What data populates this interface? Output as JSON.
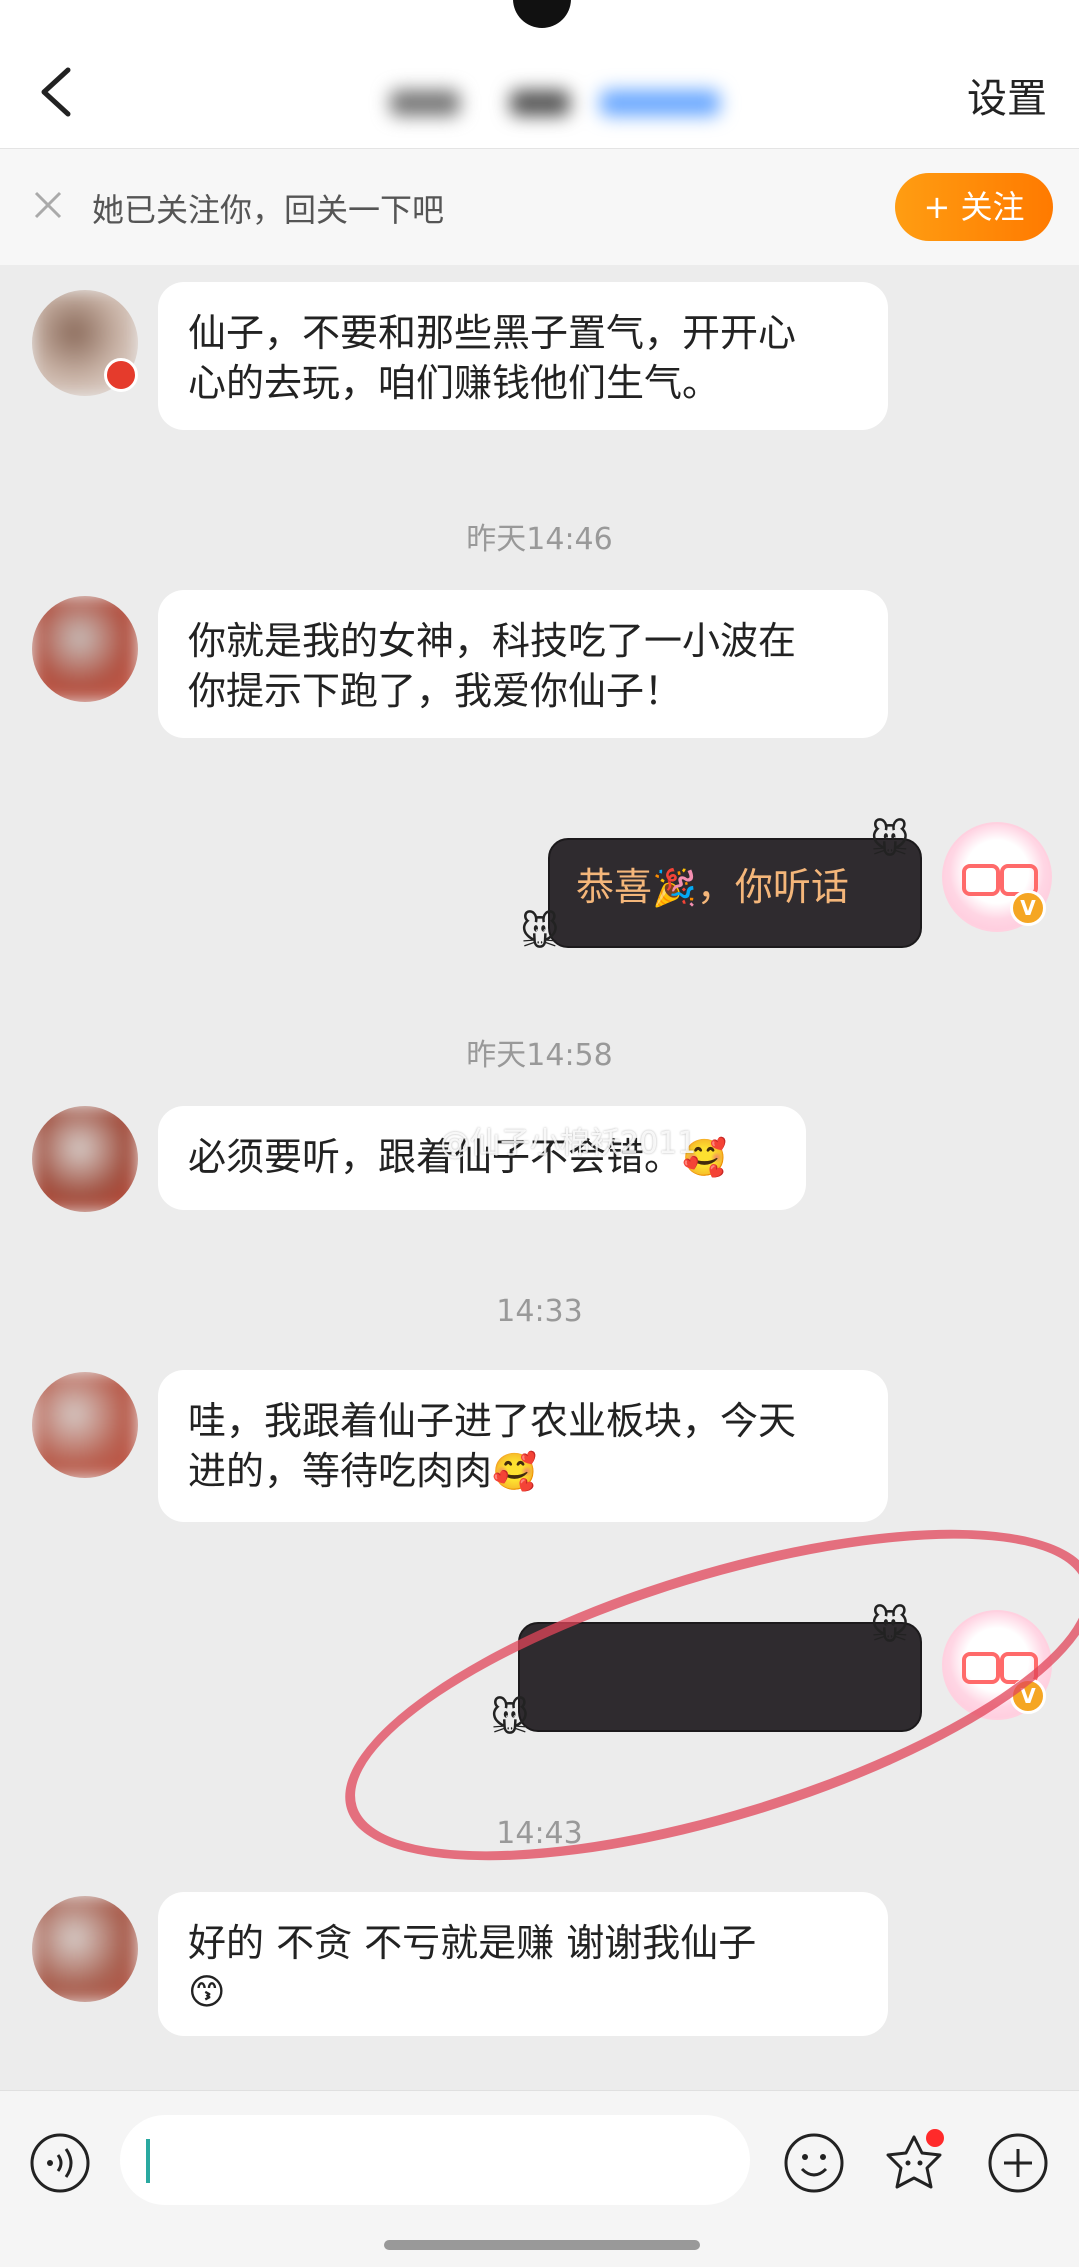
{
  "header": {
    "settings_label": "设置"
  },
  "follow_banner": {
    "text": "她已关注你，回关一下吧",
    "button_label": "+ 关注"
  },
  "messages": [
    {
      "side": "left",
      "text_lines": [
        "仙子，不要和那些黑子置气，开开心",
        "心的去玩，咱们赚钱他们生气。"
      ]
    },
    {
      "side": "left",
      "text_lines": [
        "你就是我的女神，科技吃了一小波在",
        "你提示下跑了，我爱你仙子！"
      ]
    },
    {
      "side": "right",
      "text_a": "恭喜",
      "emoji": "🎉",
      "text_b": "，你听话"
    },
    {
      "side": "left",
      "text": "必须要听，跟着仙子不会错。",
      "emoji": "🥰"
    },
    {
      "side": "left",
      "text_lines": [
        "哇，我跟着仙子进了农业板块，今天",
        "进的，等待吃肉肉"
      ],
      "emoji": "🥰"
    },
    {
      "side": "right",
      "text": ""
    },
    {
      "side": "left",
      "text_lines": [
        "好的  不贪  不亏就是赚 谢谢我仙子"
      ],
      "emoji": "😙"
    }
  ],
  "timestamps": [
    "昨天14:46",
    "昨天14:58",
    "14:33",
    "14:43"
  ],
  "watermark": "@仙子小棉袄2011",
  "colors": {
    "accent": "#ff8c0a",
    "dark_bubble": "#2f2b2f",
    "bubble_text_gold": "#f4b67a"
  },
  "icons": [
    "back-arrow-icon",
    "close-icon",
    "voice-icon",
    "emoji-icon",
    "sticker-icon",
    "plus-icon",
    "vip-badge-icon"
  ]
}
